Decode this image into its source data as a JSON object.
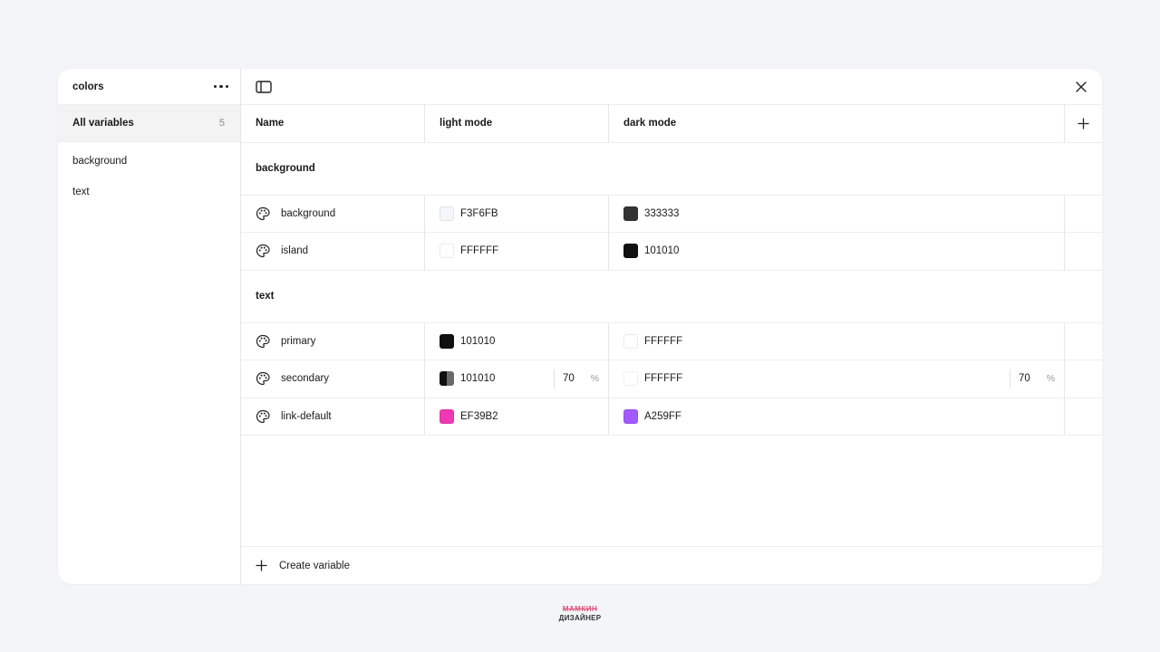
{
  "sidebar": {
    "title": "colors",
    "more_icon": "more-horizontal-icon",
    "all": {
      "label": "All variables",
      "count": "5"
    },
    "groups": [
      {
        "label": "background"
      },
      {
        "label": "text"
      }
    ]
  },
  "topbar": {
    "panel_icon": "sidebar-toggle-icon",
    "close_icon": "close-icon"
  },
  "table": {
    "headers": {
      "name": "Name",
      "light": "light mode",
      "dark": "dark mode",
      "add_icon": "plus-icon"
    },
    "groups": [
      {
        "title": "background",
        "rows": [
          {
            "name": "background",
            "light": {
              "hex": "F3F6FB",
              "color": "#F3F6FB"
            },
            "dark": {
              "hex": "333333",
              "color": "#333333"
            }
          },
          {
            "name": "island",
            "light": {
              "hex": "FFFFFF",
              "color": "#FFFFFF"
            },
            "dark": {
              "hex": "101010",
              "color": "#101010"
            }
          }
        ]
      },
      {
        "title": "text",
        "rows": [
          {
            "name": "primary",
            "light": {
              "hex": "101010",
              "color": "#101010"
            },
            "dark": {
              "hex": "FFFFFF",
              "color": "#FFFFFF"
            }
          },
          {
            "name": "secondary",
            "light": {
              "hex": "101010",
              "color": "#101010",
              "opacity": "70",
              "unit": "%"
            },
            "dark": {
              "hex": "FFFFFF",
              "color": "#FFFFFF",
              "opacity": "70",
              "unit": "%"
            }
          },
          {
            "name": "link-default",
            "light": {
              "hex": "EF39B2",
              "color": "#EF39B2"
            },
            "dark": {
              "hex": "A259FF",
              "color": "#A259FF"
            }
          }
        ]
      }
    ]
  },
  "footer": {
    "create_label": "Create variable",
    "create_icon": "plus-icon"
  },
  "watermark": {
    "line1": "МАМКИН",
    "line2": "ДИЗАЙНЕР"
  }
}
